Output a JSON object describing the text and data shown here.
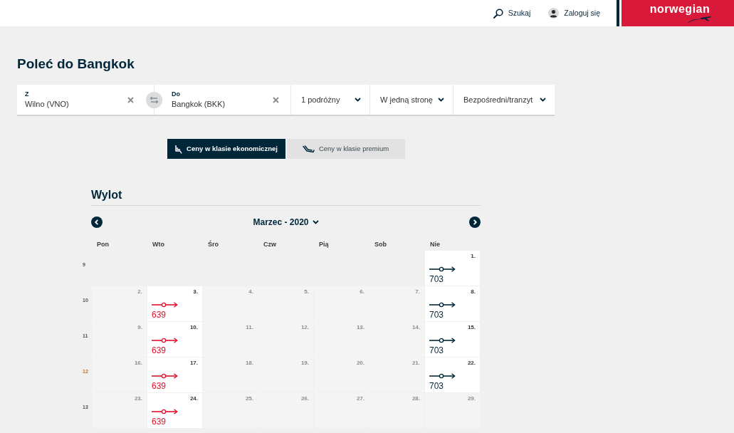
{
  "header": {
    "search": "Szukaj",
    "login": "Zaloguj się",
    "logo": "norwegian"
  },
  "page_title": "Poleć do Bangkok",
  "search_bar": {
    "from": {
      "label": "Z",
      "value": "Wilno (VNO)"
    },
    "to": {
      "label": "Do",
      "value": "Bangkok (BKK)"
    },
    "dropdowns": [
      "1 podróżny",
      "W jedną stronę",
      "Bezpośredni/tranzyt"
    ]
  },
  "fare_tabs": [
    {
      "label": "Ceny w klasie ekonomicznej",
      "selected": true
    },
    {
      "label": "Ceny w klasie premium",
      "selected": false
    }
  ],
  "calendar": {
    "title": "Wylot",
    "month": "Marzec - 2020",
    "weekdays": [
      "Pon",
      "Wto",
      "Śro",
      "Czw",
      "Pią",
      "Sob",
      "Nie"
    ],
    "weeks": [
      {
        "number": "9",
        "highlighted": false,
        "days": [
          {
            "kind": "blank"
          },
          {
            "kind": "blank"
          },
          {
            "kind": "blank"
          },
          {
            "kind": "blank"
          },
          {
            "kind": "blank"
          },
          {
            "kind": "blank"
          },
          {
            "kind": "available",
            "date": "1.",
            "price": "703",
            "cheapest": false
          }
        ]
      },
      {
        "number": "10",
        "highlighted": false,
        "days": [
          {
            "kind": "unavailable",
            "date": "2."
          },
          {
            "kind": "available",
            "date": "3.",
            "price": "639",
            "cheapest": true
          },
          {
            "kind": "unavailable",
            "date": "4."
          },
          {
            "kind": "unavailable",
            "date": "5."
          },
          {
            "kind": "unavailable",
            "date": "6."
          },
          {
            "kind": "unavailable",
            "date": "7."
          },
          {
            "kind": "available",
            "date": "8.",
            "price": "703",
            "cheapest": false
          }
        ]
      },
      {
        "number": "11",
        "highlighted": false,
        "days": [
          {
            "kind": "unavailable",
            "date": "9."
          },
          {
            "kind": "available",
            "date": "10.",
            "price": "639",
            "cheapest": true
          },
          {
            "kind": "unavailable",
            "date": "11."
          },
          {
            "kind": "unavailable",
            "date": "12."
          },
          {
            "kind": "unavailable",
            "date": "13."
          },
          {
            "kind": "unavailable",
            "date": "14."
          },
          {
            "kind": "available",
            "date": "15.",
            "price": "703",
            "cheapest": false
          }
        ]
      },
      {
        "number": "12",
        "highlighted": true,
        "days": [
          {
            "kind": "unavailable",
            "date": "16."
          },
          {
            "kind": "available",
            "date": "17.",
            "price": "639",
            "cheapest": true
          },
          {
            "kind": "unavailable",
            "date": "18."
          },
          {
            "kind": "unavailable",
            "date": "19."
          },
          {
            "kind": "unavailable",
            "date": "20."
          },
          {
            "kind": "unavailable",
            "date": "21."
          },
          {
            "kind": "available",
            "date": "22.",
            "price": "703",
            "cheapest": false
          }
        ]
      },
      {
        "number": "13",
        "highlighted": false,
        "days": [
          {
            "kind": "unavailable",
            "date": "23."
          },
          {
            "kind": "available",
            "date": "24.",
            "price": "639",
            "cheapest": true
          },
          {
            "kind": "unavailable",
            "date": "25."
          },
          {
            "kind": "unavailable",
            "date": "26."
          },
          {
            "kind": "unavailable",
            "date": "27."
          },
          {
            "kind": "unavailable",
            "date": "28."
          },
          {
            "kind": "unavailable",
            "date": "29."
          }
        ]
      }
    ]
  }
}
